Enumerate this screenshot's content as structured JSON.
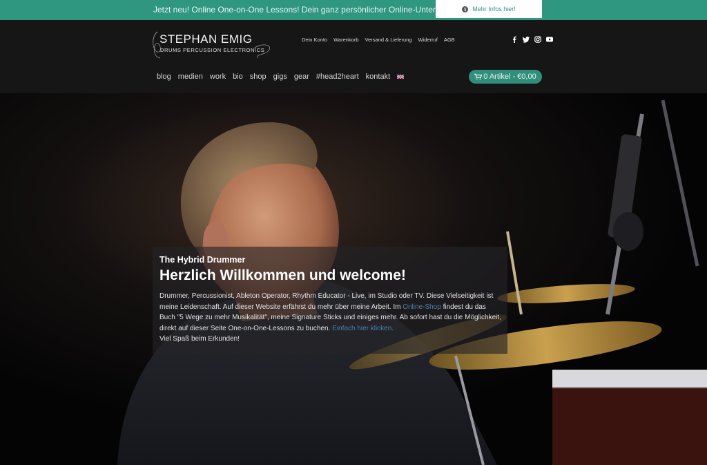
{
  "notice": {
    "text": "Jetzt neu! Online One-on-One Lessons! Dein ganz persönlicher Online-Unterricht!",
    "button_label": "Mehr Infos hier!",
    "button_icon": "info-icon"
  },
  "brand": {
    "name": "STEPHAN EMIG",
    "tagline": "DRUMS  PERCUSSION  ELECTRONICS"
  },
  "meta_nav": [
    "Dein Konto",
    "Warenkorb",
    "Versand & Lieferung",
    "Widerruf",
    "AGB"
  ],
  "social": [
    "facebook-icon",
    "twitter-icon",
    "instagram-icon",
    "youtube-icon"
  ],
  "main_nav": [
    "blog",
    "medien",
    "work",
    "bio",
    "shop",
    "gigs",
    "gear",
    "#head2heart",
    "kontakt"
  ],
  "language_flag": "uk-flag-icon",
  "cart": {
    "label": "0 Artikel - €0,00",
    "icon": "shopping-cart-icon"
  },
  "hero": {
    "kicker": "The Hybrid Drummer",
    "title": "Herzlich Willkommen und welcome!",
    "body_1": "Drummer, Percussionist, Ableton Operator, Rhythm Educator - Live, im Studio oder TV. Diese Vielseitigkeit ist meine Leidenschaft. Auf dieser Website erfährst du mehr über meine Arbeit. Im ",
    "link_shop": "Online-Shop",
    "body_2": " findest du das Buch \"5 Wege zu mehr Musikalität\", meine Signature Sticks und einiges mehr. Ab sofort hast du die Möglichkeit, direkt auf dieser Seite One-on-One-Lessons zu buchen. ",
    "link_book": "Einfach hier klicken.",
    "body_3": "Viel Spaß beim Erkunden!"
  },
  "colors": {
    "accent": "#2f9680",
    "header_bg": "#161616",
    "link": "#4e7fb3"
  }
}
